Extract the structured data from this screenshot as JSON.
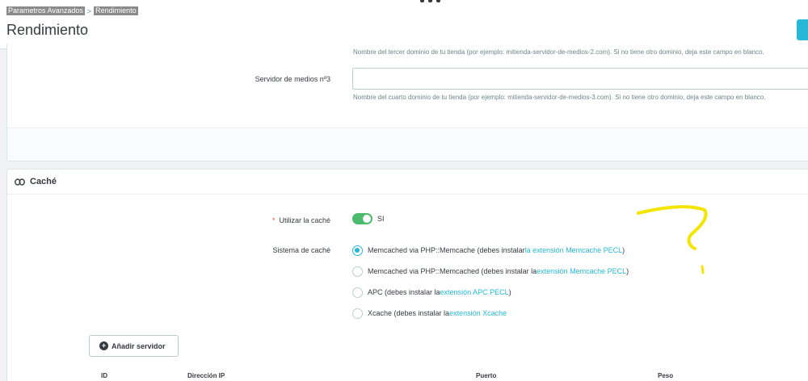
{
  "breadcrumb": {
    "parent": "Parametros Avanzados",
    "separator": ">",
    "current": "Rendimiento"
  },
  "page_title": "Rendimiento",
  "media_servers": {
    "help_3": "Nombre del tercer dominio de tu tienda (por ejemplo: mitienda-servidor-de-medios-2.com). Si no tiene otro dominio, deja este campo en blanco.",
    "label_3": "Servidor de medios nº3",
    "value_3": "",
    "help_4": "Nombre del cuarto dominio de tu tienda (por ejemplo: mitienda-servidor-de-medios-3.com). Si no tiene otro dominio, deja este campo en blanco."
  },
  "cache": {
    "title": "Caché",
    "use_cache_label": "Utilizar la caché",
    "required_mark": "*",
    "use_cache_value": "SI",
    "system_label": "Sistema de caché",
    "options": [
      {
        "text": "Memcached via PHP::Memcache (debes instalar",
        "link": "la extensión Memcache PECL",
        "suffix": ")",
        "selected": true
      },
      {
        "text": "Memcached via PHP::Memcached (debes instalar la",
        "link": "extensión Memcache PECL",
        "suffix": ")",
        "selected": false
      },
      {
        "text": "APC (debes instalar la",
        "link": "extensión APC PECL",
        "suffix": ")",
        "selected": false
      },
      {
        "text": "Xcache (debes instalar la",
        "link": "extensión Xcache",
        "suffix": "",
        "selected": false
      }
    ],
    "add_server_label": "Añadir servidor",
    "table_headers": [
      "ID",
      "Dirección IP",
      "Puerto",
      "Peso"
    ]
  },
  "colors": {
    "accent": "#25b9d7",
    "switch_on": "#4cbb6c",
    "annotation": "#f2e600"
  },
  "annotation": {
    "glyph": "?"
  }
}
